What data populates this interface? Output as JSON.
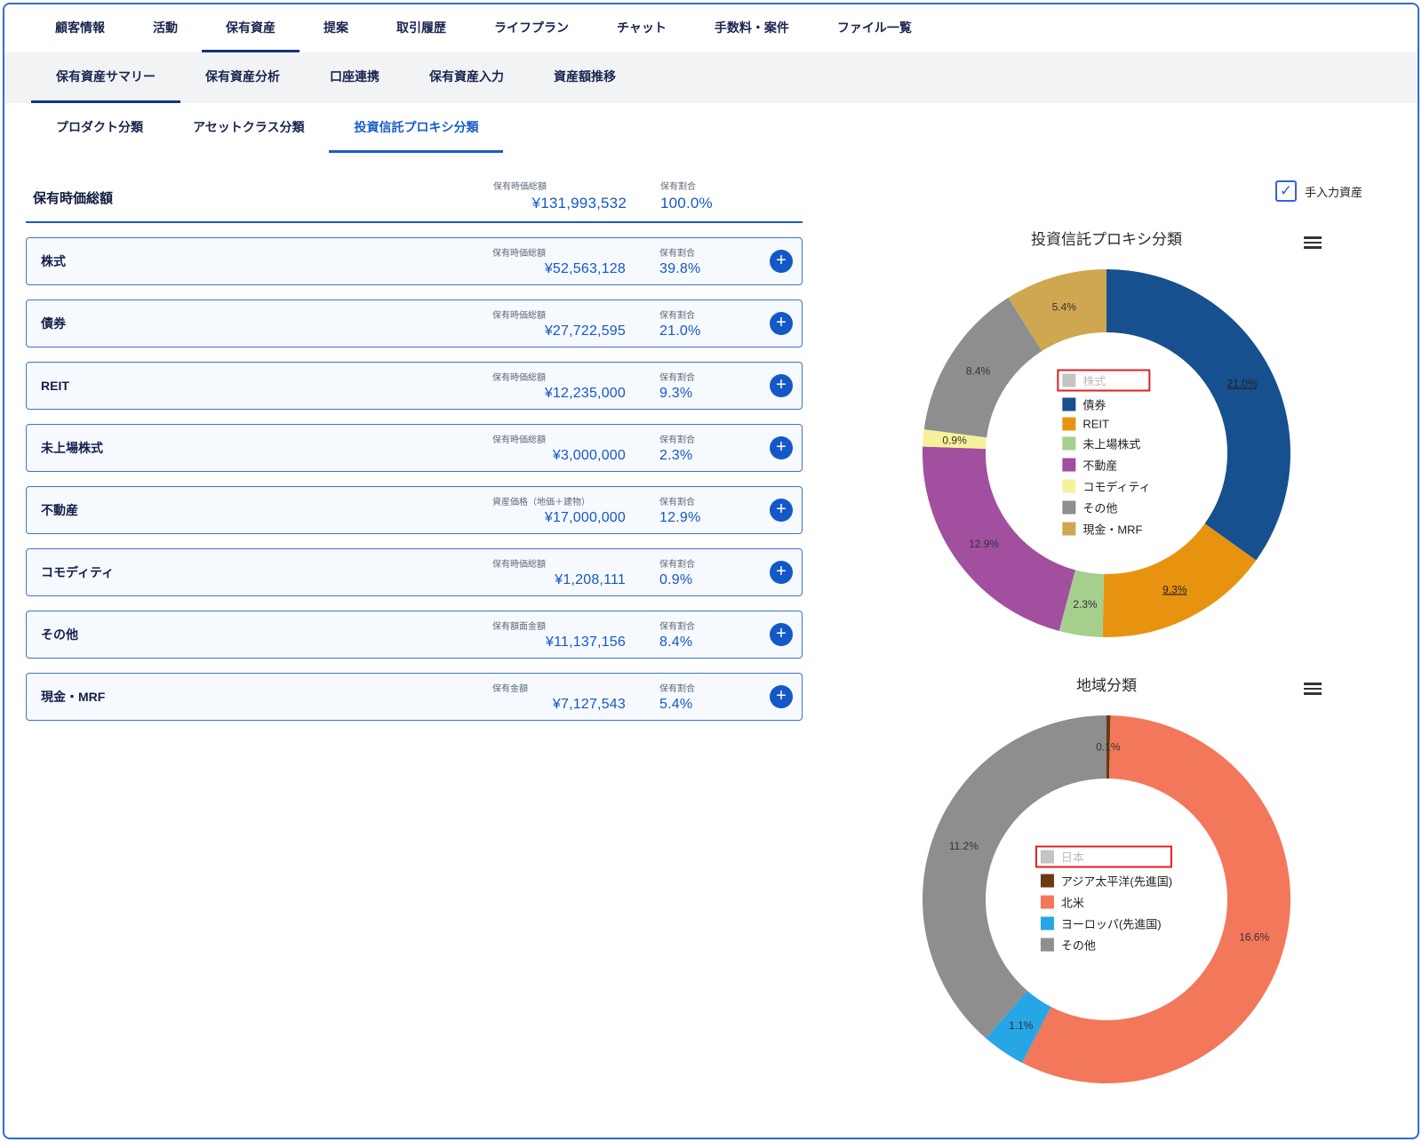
{
  "colors": {
    "accent": "#1458c8",
    "nav_active_underline": "#16337f",
    "row_border": "#3e72d2",
    "row_background": "#f6f9fe",
    "legend_highlight_box": "#e02020",
    "disabled_legend_gray": "#c4c4c4"
  },
  "top_nav": {
    "items": [
      "顧客情報",
      "活動",
      "保有資産",
      "提案",
      "取引履歴",
      "ライフプラン",
      "チャット",
      "手数料・案件",
      "ファイル一覧"
    ],
    "active_index": 2
  },
  "sub_nav": {
    "items": [
      "保有資産サマリー",
      "保有資産分析",
      "口座連携",
      "保有資産入力",
      "資産額推移"
    ],
    "active_index": 0
  },
  "category_tabs": {
    "items": [
      "プロダクト分類",
      "アセットクラス分類",
      "投資信託プロキシ分類"
    ],
    "active_index": 2
  },
  "summary": {
    "title": "保有時価総額",
    "amount_label": "保有時価総額",
    "amount": "¥131,993,532",
    "ratio_label": "保有割合",
    "ratio": "100.0%"
  },
  "assets": [
    {
      "name": "株式",
      "amount_label": "保有時価総額",
      "amount": "¥52,563,128",
      "ratio_label": "保有割合",
      "ratio": "39.8%"
    },
    {
      "name": "債券",
      "amount_label": "保有時価総額",
      "amount": "¥27,722,595",
      "ratio_label": "保有割合",
      "ratio": "21.0%"
    },
    {
      "name": "REIT",
      "amount_label": "保有時価総額",
      "amount": "¥12,235,000",
      "ratio_label": "保有割合",
      "ratio": "9.3%"
    },
    {
      "name": "未上場株式",
      "amount_label": "保有時価総額",
      "amount": "¥3,000,000",
      "ratio_label": "保有割合",
      "ratio": "2.3%"
    },
    {
      "name": "不動産",
      "amount_label": "資産価格（地価＋建物）",
      "amount": "¥17,000,000",
      "ratio_label": "保有割合",
      "ratio": "12.9%"
    },
    {
      "name": "コモディティ",
      "amount_label": "保有時価総額",
      "amount": "¥1,208,111",
      "ratio_label": "保有割合",
      "ratio": "0.9%"
    },
    {
      "name": "その他",
      "amount_label": "保有額面金額",
      "amount": "¥11,137,156",
      "ratio_label": "保有割合",
      "ratio": "8.4%"
    },
    {
      "name": "現金・MRF",
      "amount_label": "保有金額",
      "amount": "¥7,127,543",
      "ratio_label": "保有割合",
      "ratio": "5.4%"
    }
  ],
  "manual_input_checkbox": {
    "label": "手入力資産",
    "checked": true
  },
  "chart_data": [
    {
      "type": "donut",
      "title": "投資信託プロキシ分類",
      "legend_position": "center",
      "start_angle_deg": 0,
      "segments": [
        {
          "label": "債券",
          "value": 21.0,
          "display": "21.0%",
          "color": "#17508f",
          "underline": true
        },
        {
          "label": "REIT",
          "value": 9.3,
          "display": "9.3%",
          "color": "#e8930f",
          "underline": true
        },
        {
          "label": "未上場株式",
          "value": 2.3,
          "display": "2.3%",
          "color": "#a6cf8e"
        },
        {
          "label": "不動産",
          "value": 12.9,
          "display": "12.9%",
          "color": "#a14f9e"
        },
        {
          "label": "コモディティ",
          "value": 0.9,
          "display": "0.9%",
          "color": "#f6f19a"
        },
        {
          "label": "その他",
          "value": 8.4,
          "display": "8.4%",
          "color": "#8e8e8e"
        },
        {
          "label": "現金・MRF",
          "value": 5.4,
          "display": "5.4%",
          "color": "#cfa750"
        }
      ],
      "legend": [
        {
          "label": "株式",
          "color": "#c4c4c4",
          "disabled": true,
          "boxed": true
        },
        {
          "label": "債券",
          "color": "#17508f"
        },
        {
          "label": "REIT",
          "color": "#e8930f"
        },
        {
          "label": "未上場株式",
          "color": "#a6cf8e"
        },
        {
          "label": "不動産",
          "color": "#a14f9e"
        },
        {
          "label": "コモディティ",
          "color": "#f6f19a"
        },
        {
          "label": "その他",
          "color": "#8e8e8e"
        },
        {
          "label": "現金・MRF",
          "color": "#cfa750"
        }
      ]
    },
    {
      "type": "donut",
      "title": "地域分類",
      "legend_position": "center",
      "start_angle_deg": 0,
      "segments": [
        {
          "label": "アジア太平洋(先進国)",
          "value": 0.1,
          "display": "0.1%",
          "color": "#6b3a12"
        },
        {
          "label": "北米",
          "value": 16.6,
          "display": "16.6%",
          "color": "#f3775a"
        },
        {
          "label": "ヨーロッパ(先進国)",
          "value": 1.1,
          "display": "1.1%",
          "color": "#27a6e5"
        },
        {
          "label": "その他",
          "value": 11.2,
          "display": "11.2%",
          "color": "#8e8e8e"
        }
      ],
      "legend": [
        {
          "label": "日本",
          "color": "#c4c4c4",
          "disabled": true,
          "boxed": true
        },
        {
          "label": "アジア太平洋(先進国)",
          "color": "#6b3a12"
        },
        {
          "label": "北米",
          "color": "#f3775a"
        },
        {
          "label": "ヨーロッパ(先進国)",
          "color": "#27a6e5"
        },
        {
          "label": "その他",
          "color": "#8e8e8e"
        }
      ]
    }
  ]
}
